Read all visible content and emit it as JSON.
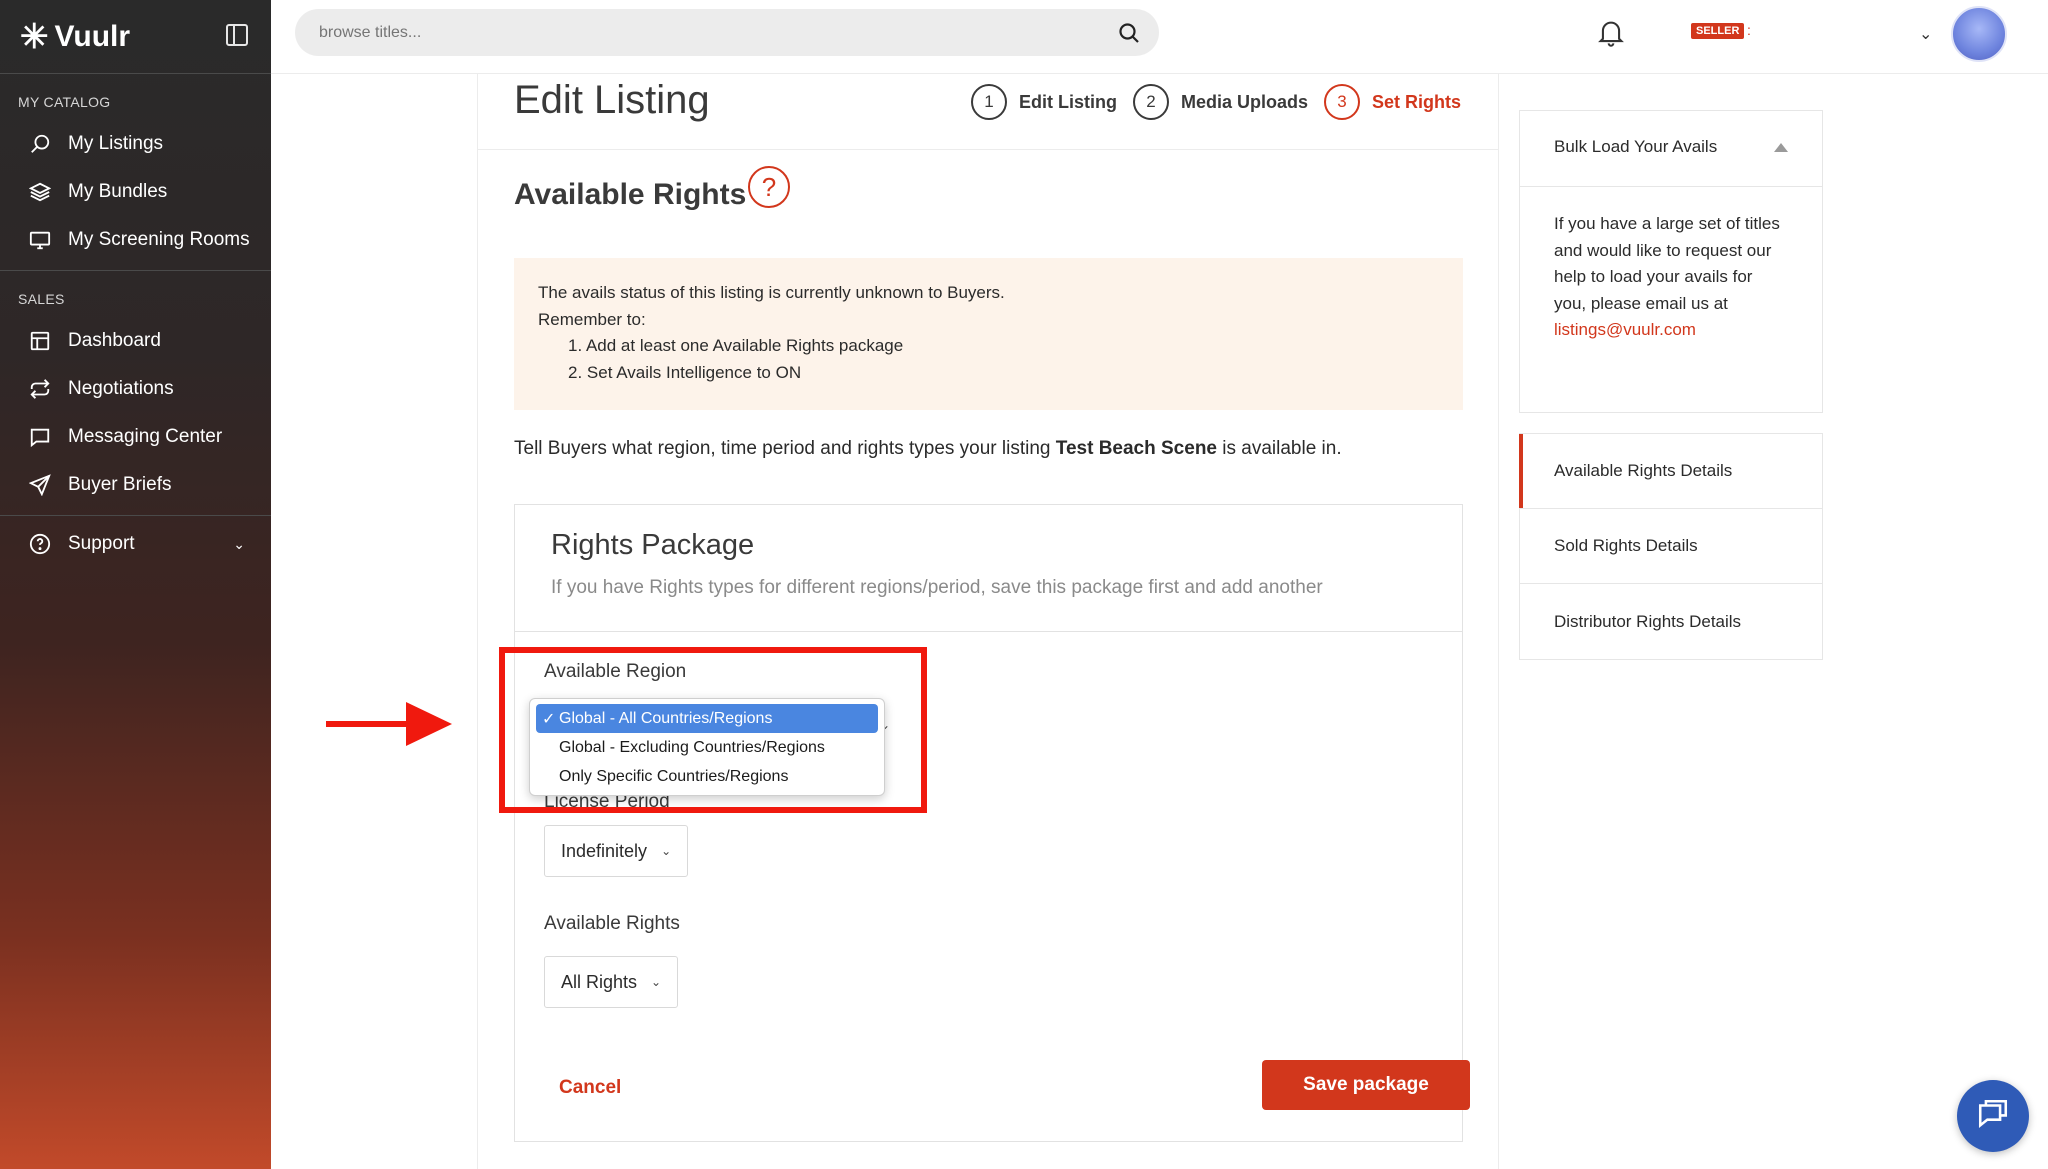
{
  "brand": {
    "name": "Vuulr"
  },
  "sidebar": {
    "sections": [
      {
        "label": "MY CATALOG",
        "items": [
          {
            "label": "My Listings",
            "icon": "search-icon"
          },
          {
            "label": "My Bundles",
            "icon": "layers-icon"
          },
          {
            "label": "My Screening Rooms",
            "icon": "monitor-icon"
          }
        ]
      },
      {
        "label": "SALES",
        "items": [
          {
            "label": "Dashboard",
            "icon": "dashboard-icon"
          },
          {
            "label": "Negotiations",
            "icon": "exchange-icon"
          },
          {
            "label": "Messaging Center",
            "icon": "message-icon"
          },
          {
            "label": "Buyer Briefs",
            "icon": "send-icon"
          }
        ]
      }
    ],
    "support": {
      "label": "Support",
      "icon": "help-circle-icon"
    }
  },
  "topbar": {
    "search_placeholder": "browse titles...",
    "seller_badge": "SELLER",
    "seller_name": ":"
  },
  "page": {
    "title": "Edit Listing",
    "steps": [
      {
        "num": "1",
        "label": "Edit Listing",
        "active": false
      },
      {
        "num": "2",
        "label": "Media Uploads",
        "active": false
      },
      {
        "num": "3",
        "label": "Set Rights",
        "active": true
      }
    ],
    "section_title": "Available Rights",
    "help_glyph": "?",
    "notice": {
      "line1": "The avails status of this listing is currently unknown to Buyers.",
      "line2": "Remember to:",
      "item1": "1. Add at least one Available Rights package",
      "item2": "2. Set Avails Intelligence to ON"
    },
    "intro_before": "Tell Buyers what region, time period and rights types your listing ",
    "intro_title": "Test Beach Scene",
    "intro_after": " is available in."
  },
  "package": {
    "title": "Rights Package",
    "subtitle": "If you have Rights types for different regions/period, save this package first and add another",
    "region_label": "Available Region",
    "region_options": [
      "Global - All Countries/Regions",
      "Global - Excluding Countries/Regions",
      "Only Specific Countries/Regions"
    ],
    "region_selected_check": "✓",
    "license_label": "License Period",
    "license_value": "Indefinitely",
    "rights_label": "Available Rights",
    "rights_value": "All Rights",
    "cancel_label": "Cancel",
    "save_label": "Save package"
  },
  "right_panel": {
    "bulk_title": "Bulk Load Your Avails",
    "bulk_text": "If you have a large set of titles and would like to request our help to load your avails for you, please email us at",
    "bulk_email": "listings@vuulr.com",
    "nav": [
      "Available Rights Details",
      "Sold Rights Details",
      "Distributor Rights Details"
    ]
  },
  "colors": {
    "accent": "#d2371c",
    "highlight": "#f0190e",
    "selected_option": "#4a86e0"
  }
}
